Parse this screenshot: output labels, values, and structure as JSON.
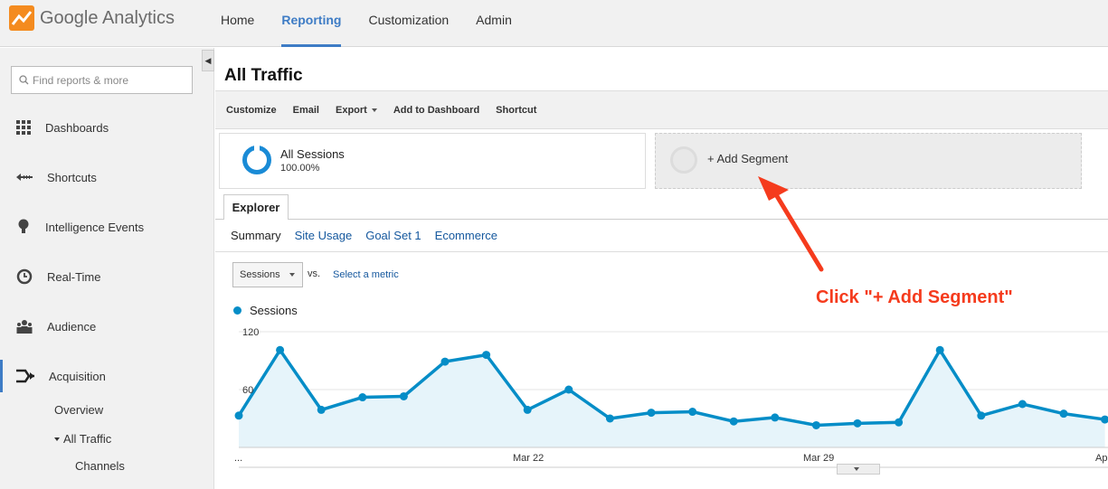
{
  "app": {
    "logo_text": "Google Analytics"
  },
  "nav": [
    "Home",
    "Reporting",
    "Customization",
    "Admin"
  ],
  "nav_active": "Reporting",
  "sidebar": {
    "search_placeholder": "Find reports & more",
    "items": [
      {
        "label": "Dashboards",
        "icon": "grid-icon"
      },
      {
        "label": "Shortcuts",
        "icon": "shortcut-arrow-icon"
      },
      {
        "label": "Intelligence Events",
        "icon": "lightbulb-icon"
      },
      {
        "label": "Real-Time",
        "icon": "clock-icon"
      },
      {
        "label": "Audience",
        "icon": "people-icon"
      },
      {
        "label": "Acquisition",
        "icon": "acquisition-arrows-icon"
      }
    ],
    "subitems": [
      "Overview",
      "All Traffic",
      "Channels"
    ]
  },
  "page": {
    "title": "All Traffic"
  },
  "toolbar": {
    "customize": "Customize",
    "email": "Email",
    "export": "Export",
    "add_dashboard": "Add to Dashboard",
    "shortcut": "Shortcut"
  },
  "segments": {
    "all_name": "All Sessions",
    "all_pct": "100.00%",
    "add_label": "+ Add Segment"
  },
  "tabs": {
    "explorer": "Explorer",
    "subtabs": [
      "Summary",
      "Site Usage",
      "Goal Set 1",
      "Ecommerce"
    ]
  },
  "metric": {
    "selected": "Sessions",
    "vs": "vs.",
    "select_metric": "Select a metric"
  },
  "annotation": {
    "text": "Click \"+ Add Segment\""
  },
  "colors": {
    "accent": "#3e7cc5",
    "series": "#058dc7",
    "callout": "#f53b1d"
  },
  "chart_data": {
    "type": "area",
    "series": [
      {
        "name": "Sessions",
        "values": [
          33,
          101,
          39,
          52,
          53,
          89,
          96,
          39,
          60,
          30,
          36,
          37,
          27,
          31,
          23,
          25,
          26,
          101,
          33,
          45,
          35,
          29
        ]
      }
    ],
    "x_tick_labels": [
      "...",
      "Mar 22",
      "Mar 29",
      "Ap"
    ],
    "y_tick_labels": [
      "120",
      "60"
    ],
    "ylim": [
      0,
      120
    ],
    "grid": true
  }
}
